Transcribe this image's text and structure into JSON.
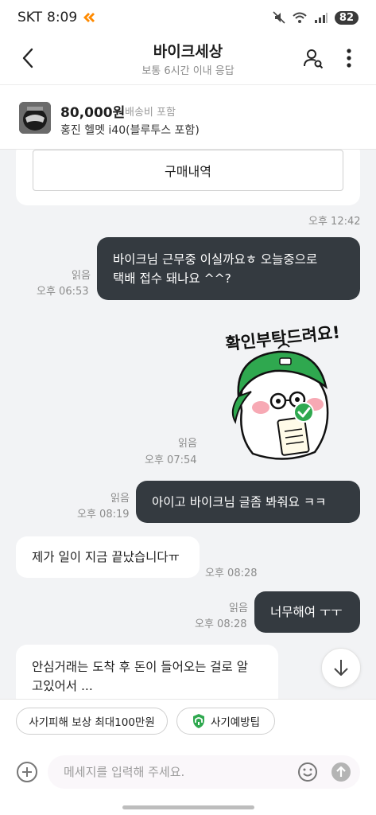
{
  "status_bar": {
    "carrier": "SKT",
    "time": "8:09",
    "battery": "82"
  },
  "header": {
    "title": "바이크세상",
    "subtitle": "보통 6시간 이내 응답"
  },
  "product": {
    "price": "80,000원",
    "shipping": "배송비 포함",
    "name": "홍진 헬멧 i40(블루투스 포함)"
  },
  "chat": {
    "card_button_label": "구매내역",
    "card_time": "오후 12:42",
    "messages": [
      {
        "sender": "me",
        "lines": [
          "바이크님  근무중 이실까요ㅎ 오늘중으로",
          "택배  접수 돼나요 ^^?"
        ],
        "read": "읽음",
        "time": "오후 06:53"
      },
      {
        "sender": "me",
        "type": "sticker",
        "sticker_text": "확인부탁드려요!",
        "read": "읽음",
        "time": "오후 07:54"
      },
      {
        "sender": "me",
        "lines": [
          "아이고  바이크님   글좀  봐줘요 ㅋㅋ"
        ],
        "read": "읽음",
        "time": "오후 08:19"
      },
      {
        "sender": "them",
        "lines": [
          "제가 일이 지금 끝났습니다ㅠ"
        ],
        "time": "오후 08:28"
      },
      {
        "sender": "me",
        "lines": [
          "너무해여 ㅜㅜ"
        ],
        "read": "읽음",
        "time": "오후 08:28"
      },
      {
        "sender": "them",
        "lines": [
          "안심거래는 도착 후 돈이 들어오는 걸로 알",
          "고있어서 ..."
        ]
      }
    ]
  },
  "quick_chips": [
    {
      "label": "사기피해 보상 최대100만원"
    },
    {
      "label": "사기예방팁"
    }
  ],
  "input": {
    "placeholder": "메세지를 입력해 주세요."
  },
  "colors": {
    "bubble_me": "#343a40",
    "bubble_them": "#ffffff",
    "chat_bg": "#f2f3f5",
    "sticker_green": "#2fa84f"
  }
}
